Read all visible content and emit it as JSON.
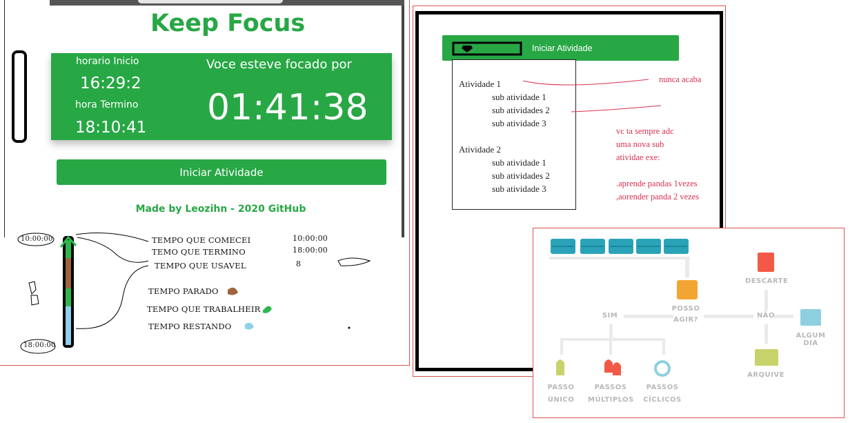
{
  "app": {
    "title": "Keep Focus",
    "start_label": "horario Inicio",
    "start_time": "16:29:2",
    "end_label": "hora Termino",
    "end_time": "18:10:41",
    "focused_label": "Voce esteve focado por",
    "focused_duration": "01:41:38",
    "start_button": "Iniciar Atividade",
    "footer": "Made by Leozihn - 2020 GitHub"
  },
  "sketch": {
    "time_top": "10:00:00",
    "time_bottom": "18:00:00",
    "rows": [
      {
        "label": "TEMPO QUE COMECEI",
        "value": "10:00:00"
      },
      {
        "label": "TEMO QUE TERMINO",
        "value": "18:00:00"
      },
      {
        "label": "TEMPO QUE USAVEL",
        "value": "8"
      }
    ],
    "legend": [
      {
        "label": "TEMPO PARADO",
        "color": "#a0643c"
      },
      {
        "label": "TEMPO QUE TRABALHEIR",
        "color": "#2db84d"
      },
      {
        "label": "TEMPO RESTANDO",
        "color": "#8fd0ea"
      }
    ]
  },
  "mockup": {
    "bar_label": "Iniciar Atividade",
    "activities": [
      {
        "title": "Atividade 1",
        "subs": [
          "sub atividade 1",
          "sub atividades 2",
          "sub atividade 3"
        ]
      },
      {
        "title": "Atividade 2",
        "subs": [
          "sub atividade 1",
          "sub atividades 2",
          "sub atividade 3"
        ]
      }
    ],
    "note_top": "nunca acaba",
    "note_lines": [
      "vc ta sempre adc",
      "uma nova sub",
      "atividae exe:",
      "",
      ".aprende pandas 1vezes",
      ",aorender panda 2 vezes"
    ]
  },
  "flow": {
    "descarte": "DESCARTE",
    "posso": "POSSO",
    "agir": "AGIR?",
    "sim": "SIM",
    "nao": "NÃO",
    "algum_dia": "ALGUM DIA",
    "arquive": "ARQUIVE",
    "passo_unico": [
      "PASSO",
      "ÚNICO"
    ],
    "passos_multiplos": [
      "PASSOS",
      "MÚLTIPLOS"
    ],
    "passos_ciclicos": [
      "PASSOS",
      "CÍCLICOS"
    ],
    "colors": {
      "teal": "#2aa3b8",
      "orange": "#f3a533",
      "red": "#f25a47",
      "lime": "#c7d36a",
      "sky": "#8fd0e0"
    }
  }
}
